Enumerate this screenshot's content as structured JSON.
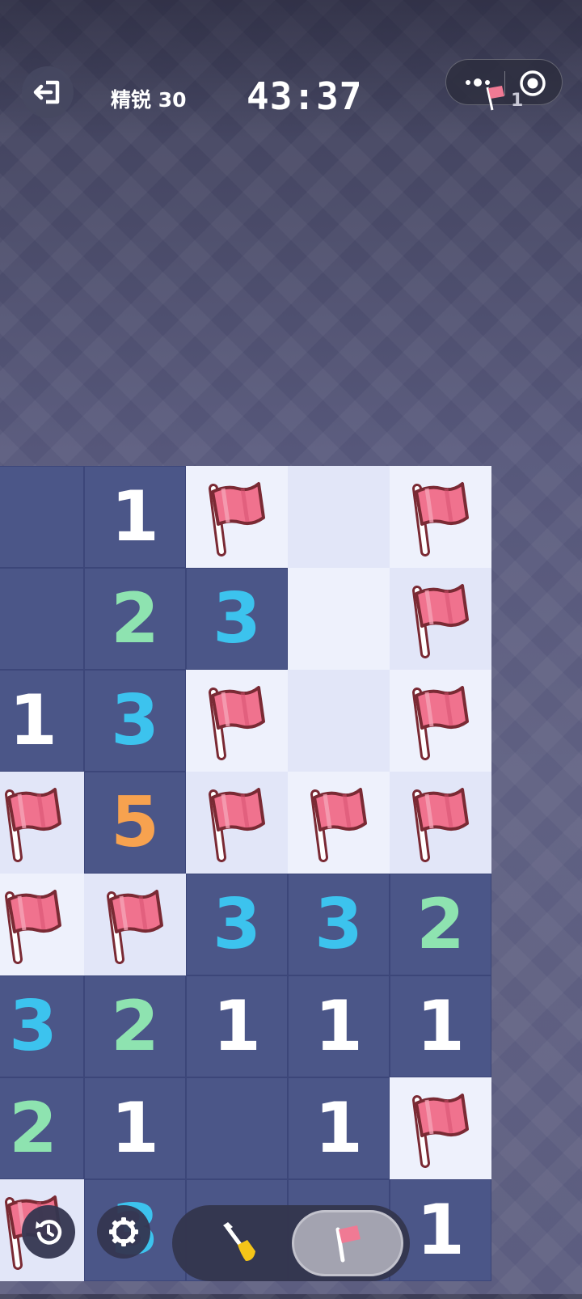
{
  "header": {
    "level": "精锐 30",
    "timer": "43:37",
    "flag_count": "1"
  },
  "icons": {
    "exit": "exit-icon",
    "more": "more-dots-icon",
    "close": "target-close-icon",
    "flag": "flag-icon",
    "restart": "restart-icon",
    "settings": "gear-icon",
    "dig": "shovel-icon"
  },
  "colors": {
    "open_cell": "#4b5688",
    "hidden_cell": "#eef1fc",
    "number_1": "#ffffff",
    "number_2": "#8ee3b0",
    "number_3": "#3cc3ee",
    "number_5": "#f7a24f",
    "flag": "#f0728e"
  },
  "board": {
    "rows": [
      [
        {
          "s": "open",
          "v": ""
        },
        {
          "s": "open",
          "v": "1"
        },
        {
          "s": "flag",
          "v": ""
        },
        {
          "s": "hidden",
          "v": ""
        },
        {
          "s": "flag",
          "v": ""
        }
      ],
      [
        {
          "s": "open",
          "v": ""
        },
        {
          "s": "open",
          "v": "2"
        },
        {
          "s": "open",
          "v": "3"
        },
        {
          "s": "hidden",
          "v": ""
        },
        {
          "s": "flag",
          "v": ""
        }
      ],
      [
        {
          "s": "open",
          "v": "1"
        },
        {
          "s": "open",
          "v": "3"
        },
        {
          "s": "flag",
          "v": ""
        },
        {
          "s": "hidden",
          "v": ""
        },
        {
          "s": "flag",
          "v": ""
        }
      ],
      [
        {
          "s": "flag",
          "v": ""
        },
        {
          "s": "open",
          "v": "5"
        },
        {
          "s": "flag",
          "v": ""
        },
        {
          "s": "flag",
          "v": ""
        },
        {
          "s": "flag",
          "v": ""
        }
      ],
      [
        {
          "s": "flag",
          "v": ""
        },
        {
          "s": "flag",
          "v": ""
        },
        {
          "s": "open",
          "v": "3"
        },
        {
          "s": "open",
          "v": "3"
        },
        {
          "s": "open",
          "v": "2"
        }
      ],
      [
        {
          "s": "open",
          "v": "3"
        },
        {
          "s": "open",
          "v": "2"
        },
        {
          "s": "open",
          "v": "1"
        },
        {
          "s": "open",
          "v": "1"
        },
        {
          "s": "open",
          "v": "1"
        }
      ],
      [
        {
          "s": "open",
          "v": "2"
        },
        {
          "s": "open",
          "v": "1"
        },
        {
          "s": "open",
          "v": ""
        },
        {
          "s": "open",
          "v": "1"
        },
        {
          "s": "flag",
          "v": ""
        }
      ],
      [
        {
          "s": "flag",
          "v": ""
        },
        {
          "s": "open",
          "v": "3"
        },
        {
          "s": "open",
          "v": ""
        },
        {
          "s": "open",
          "v": ""
        },
        {
          "s": "open",
          "v": "1"
        }
      ]
    ]
  },
  "toolbar": {
    "active_mode": "flag"
  }
}
